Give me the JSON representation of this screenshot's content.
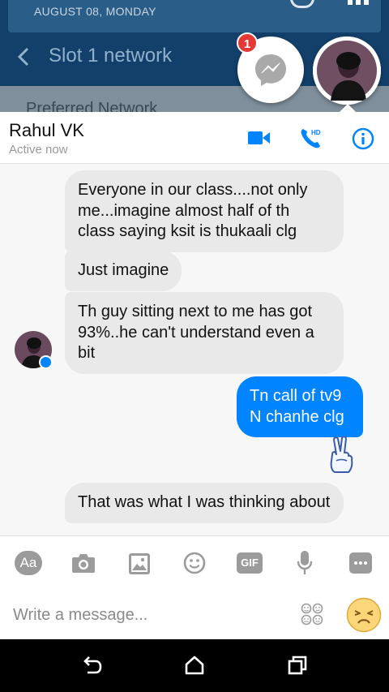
{
  "background_app": {
    "date_text": "AUGUST 08, MONDAY",
    "title": "Slot 1 network",
    "subtitle": "Preferred Network"
  },
  "chat_heads": {
    "unread_count": "1"
  },
  "chat_header": {
    "name": "Rahul VK",
    "status": "Active now",
    "hd_label": "HD"
  },
  "messages": [
    {
      "direction": "incoming",
      "text": "Everyone in our class....not only me...imagine almost half of th class saying ksit is thukaali clg"
    },
    {
      "direction": "incoming",
      "text": "Just imagine"
    },
    {
      "direction": "incoming",
      "text": "Th guy sitting next to me has got 93%..he can't understand even a bit"
    },
    {
      "direction": "outgoing",
      "text": "Tn call of tv9 N chanhe clg"
    },
    {
      "direction": "outgoing",
      "sticker": "peace-hand-icon"
    },
    {
      "direction": "incoming",
      "text": "That was what I was thinking about"
    }
  ],
  "toolbar": {
    "aa_label": "Aa",
    "gif_label": "GIF"
  },
  "composer": {
    "placeholder": "Write a message..."
  },
  "colors": {
    "accent": "#0084ff",
    "incoming_bubble": "#e9e9e9",
    "badge": "#e53935"
  }
}
